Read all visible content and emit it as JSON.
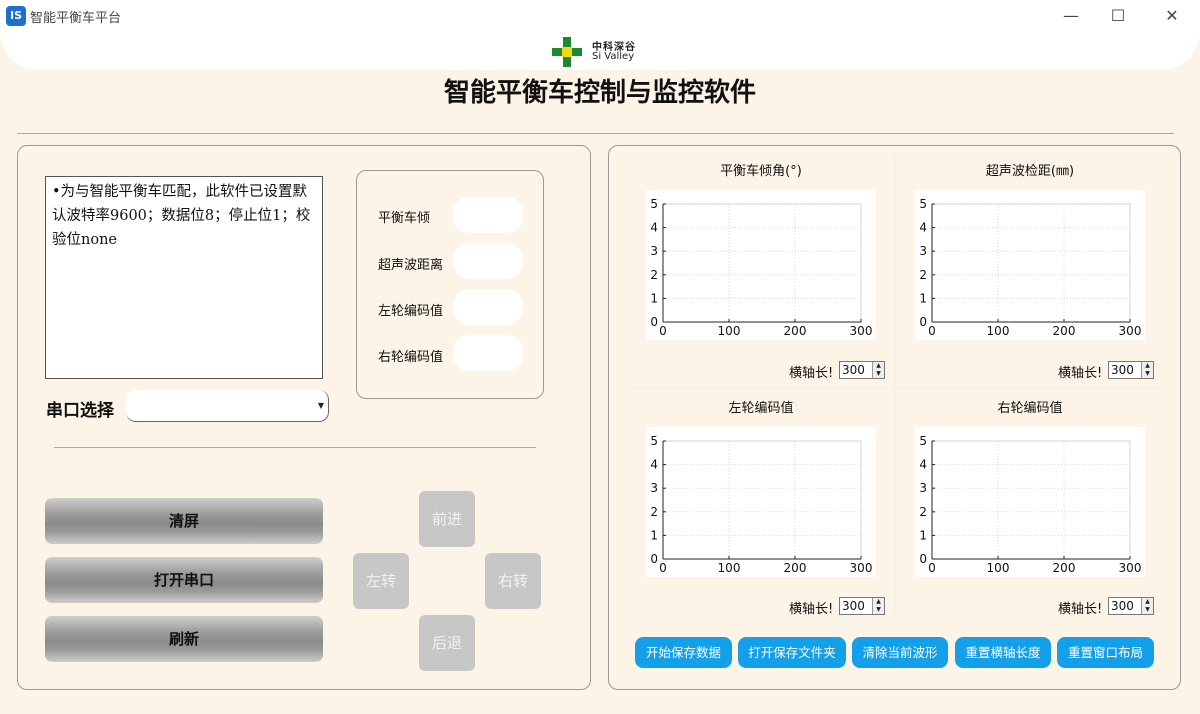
{
  "window": {
    "app_icon_text": "IS",
    "title": "智能平衡车平台",
    "minimize_glyph": "—",
    "maximize_glyph": "☐",
    "close_glyph": "✕"
  },
  "logo": {
    "name_cn": "中科深谷",
    "name_en": "Si Valley"
  },
  "main_title": "智能平衡车控制与监控软件",
  "notice_text": "•为与智能平衡车匹配，此软件已设置默认波特率9600；数据位8；停止位1；校验位none",
  "readouts": {
    "tilt_label": "平衡车倾",
    "ultrasonic_label": "超声波距离",
    "left_encoder_label": "左轮编码值",
    "right_encoder_label": "右轮编码值"
  },
  "serial": {
    "label": "串口选择",
    "selected": ""
  },
  "buttons": {
    "clear": "清屏",
    "open_port": "打开串口",
    "refresh": "刷新"
  },
  "direction": {
    "forward": "前进",
    "left": "左转",
    "right": "右转",
    "back": "后退"
  },
  "charts": [
    {
      "title": "平衡车倾角(°)",
      "axis_label": "横轴长!",
      "axis_length": "300"
    },
    {
      "title": "超声波检距(㎜)",
      "axis_label": "横轴长!",
      "axis_length": "300"
    },
    {
      "title": "左轮编码值",
      "axis_label": "横轴长!",
      "axis_length": "300"
    },
    {
      "title": "右轮编码值",
      "axis_label": "横轴长!",
      "axis_length": "300"
    }
  ],
  "chart_data": {
    "type": "line",
    "x_ticks": [
      "0",
      "100",
      "200",
      "300"
    ],
    "y_ticks": [
      "0",
      "1",
      "2",
      "3",
      "4",
      "5"
    ],
    "xlim": [
      0,
      300
    ],
    "ylim": [
      0,
      5
    ],
    "grid": true,
    "series": []
  },
  "action_buttons": {
    "start_save": "开始保存数据",
    "open_folder": "打开保存文件夹",
    "clear_wave": "清除当前波形",
    "reset_axis": "重置横轴长度",
    "reset_layout": "重置窗口布局"
  },
  "colors": {
    "background": "#fcf4e6",
    "accent_blue": "#14a0e8",
    "logo_green": "#1e8a2f",
    "logo_yellow": "#f0d81a"
  }
}
